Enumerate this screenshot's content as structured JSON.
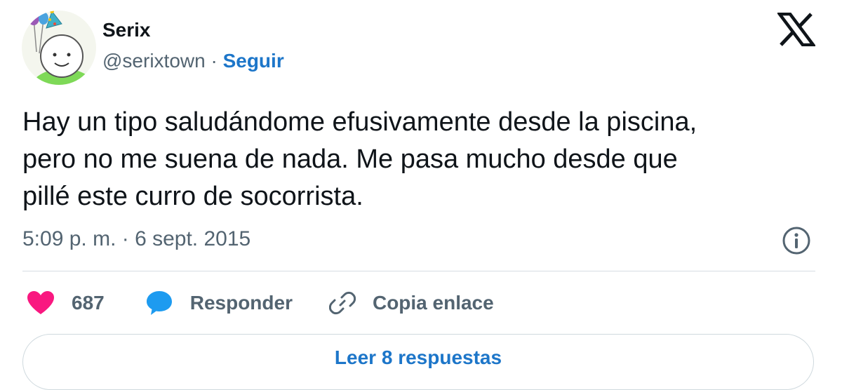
{
  "author": {
    "name": "Serix",
    "handle": "@serixtown",
    "separator": "·",
    "follow_label": "Seguir"
  },
  "tweet": {
    "lines": [
      "Hay un tipo saludándome efusivamente desde la piscina,",
      "pero no me suena de nada. Me pasa mucho desde que",
      "pillé este curro de socorrista."
    ],
    "timestamp": "5:09 p. m. · 6 sept. 2015"
  },
  "actions": {
    "likes_count": "687",
    "reply_label": "Responder",
    "copy_label": "Copia enlace"
  },
  "read_replies_label": "Leer 8 respuestas",
  "icons": {
    "brand": "x-logo-icon",
    "info": "info-icon",
    "like": "heart-icon",
    "reply": "speech-bubble-icon",
    "copy": "link-icon"
  },
  "colors": {
    "heart": "#f91880",
    "reply_bubble": "#1d9bf0",
    "link_text": "#1d76c9",
    "secondary_text": "#536471"
  }
}
